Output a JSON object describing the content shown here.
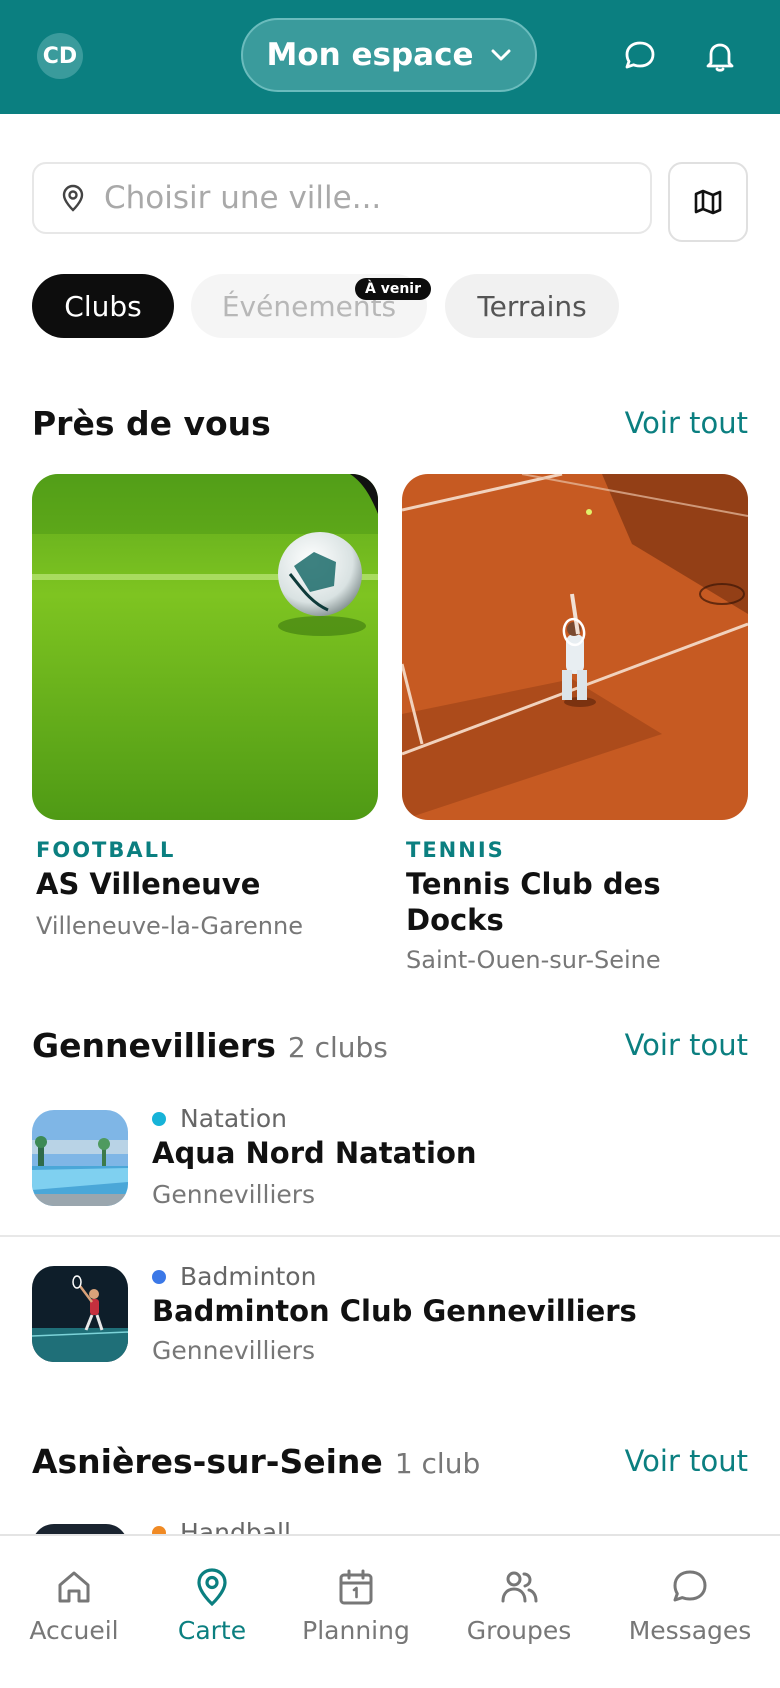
{
  "header": {
    "avatar_initials": "CD",
    "space_label": "Mon espace",
    "icons": [
      "chevron-down-icon",
      "chat-icon",
      "bell-icon"
    ]
  },
  "search": {
    "placeholder": "Choisir une ville..."
  },
  "tabs": [
    {
      "label": "Clubs",
      "active": true
    },
    {
      "label": "Événements",
      "badge": "À venir",
      "disabled": true
    },
    {
      "label": "Terrains"
    }
  ],
  "nearby": {
    "title": "Près de vous",
    "see_all": "Voir tout",
    "cards": [
      {
        "sport": "FOOTBALL",
        "name": "AS Villeneuve",
        "city": "Villeneuve-la-Garenne"
      },
      {
        "sport": "TENNIS",
        "name": "Tennis Club des Docks",
        "city": "Saint-Ouen-sur-Seine"
      }
    ]
  },
  "gennevilliers": {
    "title": "Gennevilliers",
    "count": "2 clubs",
    "see_all": "Voir tout",
    "clubs": [
      {
        "sport": "Natation",
        "dot_color": "#17b3d8",
        "name": "Aqua Nord Natation",
        "city": "Gennevilliers"
      },
      {
        "sport": "Badminton",
        "dot_color": "#3b78e7",
        "name": "Badminton Club Gennevilliers",
        "city": "Gennevilliers"
      }
    ]
  },
  "asnieres": {
    "title": "Asnières-sur-Seine",
    "count": "1 club",
    "see_all": "Voir tout",
    "clubs": [
      {
        "sport": "Handball",
        "dot_color": "#f08a24"
      }
    ]
  },
  "bottom_nav": [
    {
      "label": "Accueil",
      "icon": "home-icon"
    },
    {
      "label": "Carte",
      "icon": "map-pin-icon",
      "active": true
    },
    {
      "label": "Planning",
      "icon": "calendar-icon"
    },
    {
      "label": "Groupes",
      "icon": "users-icon"
    },
    {
      "label": "Messages",
      "icon": "message-icon"
    }
  ],
  "colors": {
    "brand": "#0b7f80",
    "active_tab": "#0d0d0d"
  }
}
